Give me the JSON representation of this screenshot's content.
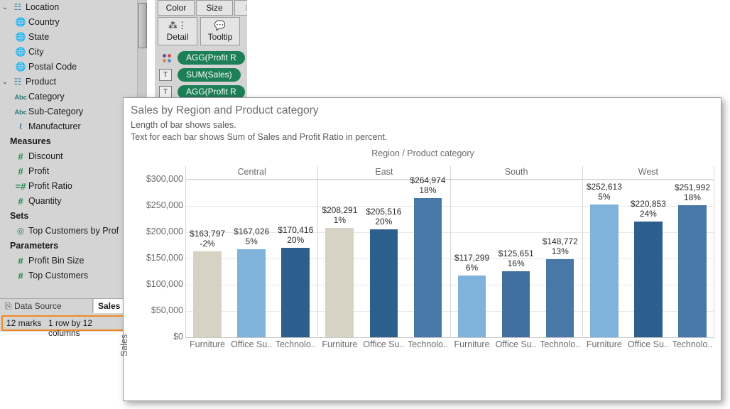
{
  "sidebar": {
    "groups": [
      {
        "label": "Location",
        "icon": "hierarchy-icon",
        "caret": "⌄",
        "items": [
          {
            "label": "Country",
            "icon": "globe-icon"
          },
          {
            "label": "State",
            "icon": "globe-icon"
          },
          {
            "label": "City",
            "icon": "globe-icon"
          },
          {
            "label": "Postal Code",
            "icon": "globe-icon"
          }
        ]
      },
      {
        "label": "Product",
        "icon": "hierarchy-icon",
        "caret": "⌄",
        "items": [
          {
            "label": "Category",
            "icon": "abc-icon",
            "glyph": "Abc"
          },
          {
            "label": "Sub-Category",
            "icon": "abc-icon",
            "glyph": "Abc"
          },
          {
            "label": "Manufacturer",
            "icon": "paperclip-icon",
            "glyph": "ℓ"
          }
        ]
      }
    ],
    "sections": [
      {
        "header": "Measures",
        "items": [
          {
            "label": "Discount",
            "icon": "number-icon",
            "glyph": "#"
          },
          {
            "label": "Profit",
            "icon": "number-icon",
            "glyph": "#"
          },
          {
            "label": "Profit Ratio",
            "icon": "calculated-number-icon",
            "glyph": "=#"
          },
          {
            "label": "Quantity",
            "icon": "number-icon",
            "glyph": "#"
          }
        ]
      },
      {
        "header": "Sets",
        "items": [
          {
            "label": "Top Customers by Prof",
            "icon": "set-icon",
            "glyph": "◎"
          }
        ]
      },
      {
        "header": "Parameters",
        "items": [
          {
            "label": "Profit Bin Size",
            "icon": "number-icon",
            "glyph": "#"
          },
          {
            "label": "Top Customers",
            "icon": "number-icon",
            "glyph": "#"
          }
        ]
      }
    ]
  },
  "tabs": {
    "data_source": "Data Source",
    "data_source_icon": "database-icon",
    "sheet": "Sales"
  },
  "status": {
    "marks": "12 marks",
    "dimensions": "1 row by 12 columns",
    "highlight_color": "#f08a24"
  },
  "marks_card": {
    "buttons": [
      {
        "label": "Color",
        "icon": "color-icon"
      },
      {
        "label": "Size",
        "icon": "size-icon"
      },
      {
        "label": "L",
        "icon": "label-icon"
      },
      {
        "label": "Detail",
        "icon": "detail-icon"
      },
      {
        "label": "Tooltip",
        "icon": "tooltip-icon"
      }
    ],
    "pills": [
      {
        "label": "AGG(Profit R",
        "icon": "color-swatch-icon"
      },
      {
        "label": "SUM(Sales)",
        "icon": "text-icon",
        "glyph": "T"
      },
      {
        "label": "AGG(Profit R",
        "icon": "text-icon",
        "glyph": "T"
      }
    ],
    "pill_color": "#1d7f56"
  },
  "viz": {
    "title": "Sales by Region and Product category",
    "subtitle_1": "Length of bar shows sales.",
    "subtitle_2": "Text for each bar shows Sum of Sales and Profit Ratio in percent.",
    "column_title": "Region / Product category",
    "y_axis_title": "Sales"
  },
  "chart_data": {
    "type": "bar",
    "title": "Sales by Region and Product category",
    "xlabel": "Region / Product category",
    "ylabel": "Sales",
    "ylim": [
      0,
      300000
    ],
    "yticks": [
      "$0",
      "$50,000",
      "$100,000",
      "$150,000",
      "$200,000",
      "$250,000",
      "$300,000"
    ],
    "ytick_values": [
      0,
      50000,
      100000,
      150000,
      200000,
      250000,
      300000
    ],
    "grid": true,
    "legend": "none",
    "group_label": "Region",
    "category_label": "Product category",
    "groups": [
      {
        "name": "Central",
        "bars": [
          {
            "category": "Furniture",
            "label": "Furniture",
            "value": 163797,
            "value_label": "$163,797",
            "ratio_label": "-2%",
            "profit_ratio": -2,
            "color": "#d6d3c4"
          },
          {
            "category": "Office Supplies",
            "label": "Office Su..",
            "value": 167026,
            "value_label": "$167,026",
            "ratio_label": "5%",
            "profit_ratio": 5,
            "color": "#7fb3dc"
          },
          {
            "category": "Technology",
            "label": "Technolo..",
            "value": 170416,
            "value_label": "$170,416",
            "ratio_label": "20%",
            "profit_ratio": 20,
            "color": "#2d5f8e"
          }
        ]
      },
      {
        "name": "East",
        "bars": [
          {
            "category": "Furniture",
            "label": "Furniture",
            "value": 208291,
            "value_label": "$208,291",
            "ratio_label": "1%",
            "profit_ratio": 1,
            "color": "#d6d3c4"
          },
          {
            "category": "Office Supplies",
            "label": "Office Su..",
            "value": 205516,
            "value_label": "$205,516",
            "ratio_label": "20%",
            "profit_ratio": 20,
            "color": "#2d5f8e"
          },
          {
            "category": "Technology",
            "label": "Technolo..",
            "value": 264974,
            "value_label": "$264,974",
            "ratio_label": "18%",
            "profit_ratio": 18,
            "color": "#4878a8"
          }
        ]
      },
      {
        "name": "South",
        "bars": [
          {
            "category": "Furniture",
            "label": "Furniture",
            "value": 117299,
            "value_label": "$117,299",
            "ratio_label": "6%",
            "profit_ratio": 6,
            "color": "#7fb3dc"
          },
          {
            "category": "Office Supplies",
            "label": "Office Su..",
            "value": 125651,
            "value_label": "$125,651",
            "ratio_label": "16%",
            "profit_ratio": 16,
            "color": "#416f9f"
          },
          {
            "category": "Technology",
            "label": "Technolo..",
            "value": 148772,
            "value_label": "$148,772",
            "ratio_label": "13%",
            "profit_ratio": 13,
            "color": "#4878a8"
          }
        ]
      },
      {
        "name": "West",
        "bars": [
          {
            "category": "Furniture",
            "label": "Furniture",
            "value": 252613,
            "value_label": "$252,613",
            "ratio_label": "5%",
            "profit_ratio": 5,
            "color": "#7fb3dc"
          },
          {
            "category": "Office Supplies",
            "label": "Office Su..",
            "value": 220853,
            "value_label": "$220,853",
            "ratio_label": "24%",
            "profit_ratio": 24,
            "color": "#2d5f8e"
          },
          {
            "category": "Technology",
            "label": "Technolo..",
            "value": 251992,
            "value_label": "$251,992",
            "ratio_label": "18%",
            "profit_ratio": 18,
            "color": "#4878a8"
          }
        ]
      }
    ]
  }
}
